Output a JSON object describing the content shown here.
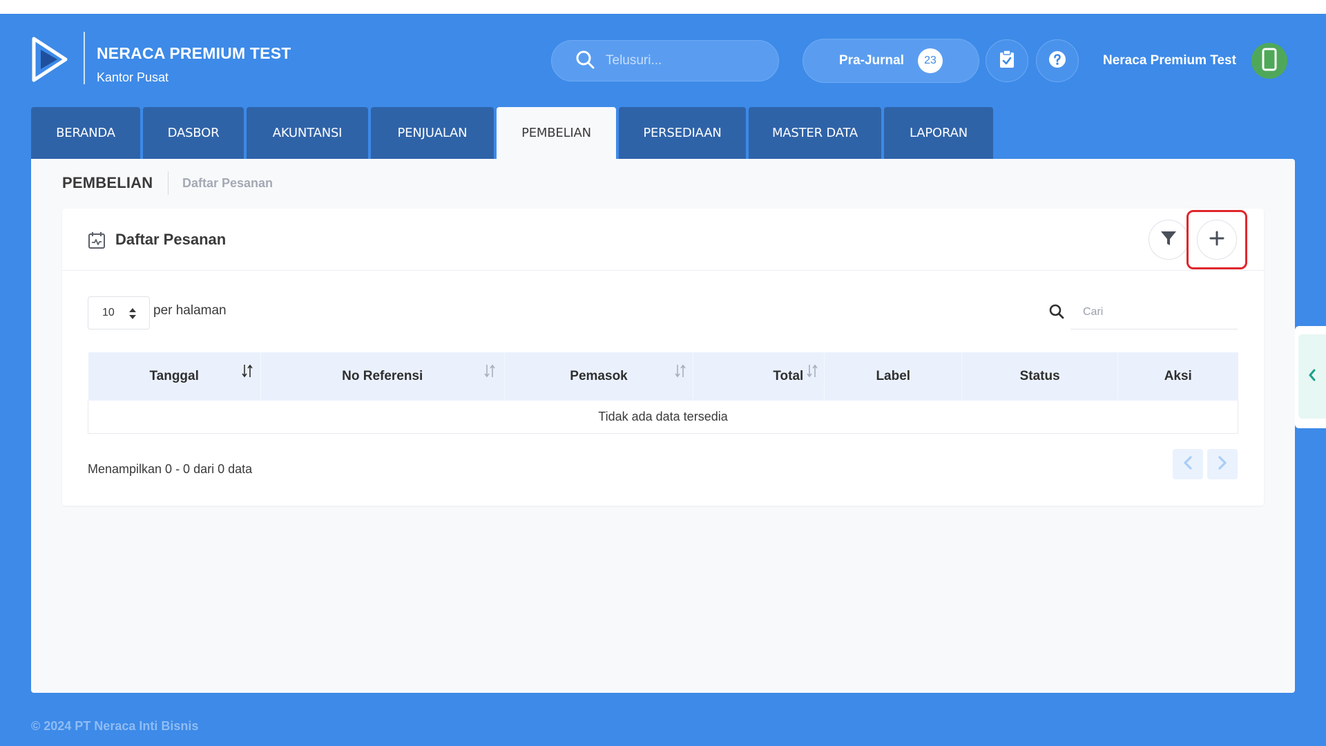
{
  "header": {
    "company_name": "NERACA PREMIUM TEST",
    "branch_name": "Kantor Pusat",
    "search_placeholder": "Telusuri...",
    "prajurnal_label": "Pra-Jurnal",
    "prajurnal_count": "23",
    "user_name": "Neraca Premium Test",
    "icons": [
      "logo-icon",
      "search-icon",
      "clipboard-check-icon",
      "help-icon",
      "smartphone-icon"
    ]
  },
  "nav": {
    "tabs": [
      {
        "label": "BERANDA",
        "active": false
      },
      {
        "label": "DASBOR",
        "active": false
      },
      {
        "label": "AKUNTANSI",
        "active": false
      },
      {
        "label": "PENJUALAN",
        "active": false
      },
      {
        "label": "PEMBELIAN",
        "active": true
      },
      {
        "label": "PERSEDIAAN",
        "active": false
      },
      {
        "label": "MASTER DATA",
        "active": false
      },
      {
        "label": "LAPORAN",
        "active": false
      }
    ]
  },
  "breadcrumb": {
    "main": "PEMBELIAN",
    "sub": "Daftar Pesanan"
  },
  "card": {
    "title": "Daftar Pesanan",
    "per_page_value": "10",
    "per_page_label": "per halaman",
    "search_placeholder": "Cari",
    "columns": [
      "Tanggal",
      "No Referensi",
      "Pemasok",
      "Total",
      "Label",
      "Status",
      "Aksi"
    ],
    "empty_message": "Tidak ada data tersedia",
    "footer_info": "Menampilkan 0 - 0 dari 0 data"
  },
  "footer": {
    "copyright": "© 2024 PT Neraca Inti Bisnis"
  },
  "colors": {
    "primary": "#3d8ae8",
    "tab": "#2f63a8",
    "highlight": "#e0262c",
    "avatar": "#4fa85a"
  }
}
